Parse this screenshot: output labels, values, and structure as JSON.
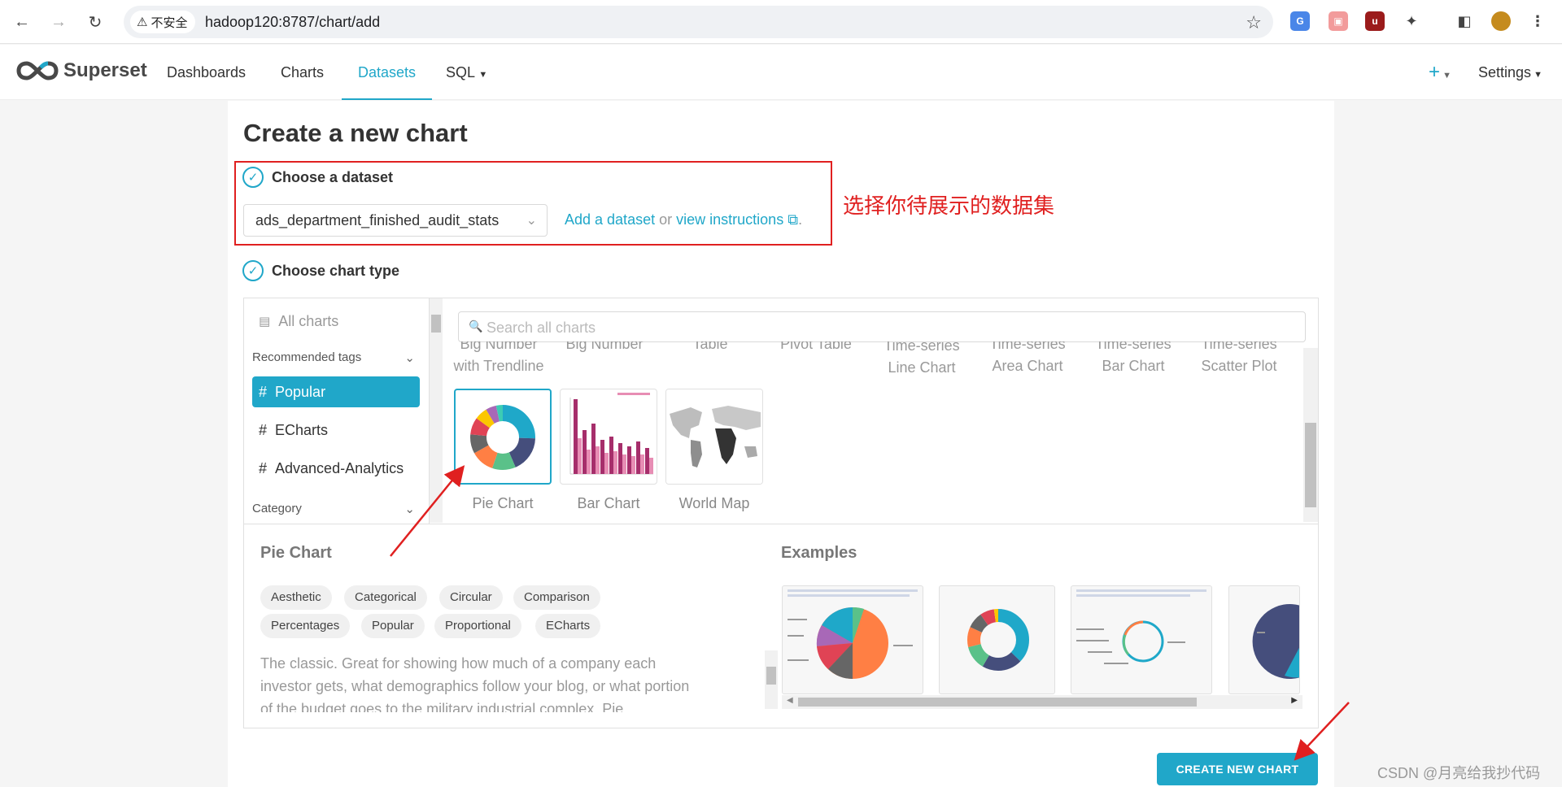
{
  "browser": {
    "insecure_label": "不安全",
    "url": "hadoop120:8787/chart/add"
  },
  "nav": {
    "brand": "Superset",
    "items": [
      {
        "label": "Dashboards",
        "active": false
      },
      {
        "label": "Charts",
        "active": false
      },
      {
        "label": "Datasets",
        "active": true
      },
      {
        "label": "SQL",
        "active": false
      }
    ],
    "plus_label": "+",
    "settings_label": "Settings"
  },
  "page": {
    "title": "Create a new chart",
    "step1_label": "Choose a dataset",
    "dataset_value": "ads_department_finished_audit_stats",
    "add_dataset_link": "Add a dataset",
    "or_text": "or",
    "view_instructions_link": "view instructions",
    "step2_label": "Choose chart type",
    "annotation": "选择你待展示的数据集"
  },
  "sidebar": {
    "all_charts": "All charts",
    "recommended_tags_header": "Recommended tags",
    "tags": [
      {
        "label": "Popular",
        "active": true
      },
      {
        "label": "ECharts",
        "active": false
      },
      {
        "label": "Advanced-Analytics",
        "active": false
      }
    ],
    "category_header": "Category"
  },
  "search": {
    "placeholder": "Search all charts"
  },
  "gallery": {
    "top_row": [
      {
        "line1": "Big Number",
        "line2": "with Trendline"
      },
      {
        "line1": "Big Number",
        "line2": ""
      },
      {
        "line1": "Table",
        "line2": ""
      },
      {
        "line1": "Pivot Table",
        "line2": ""
      },
      {
        "line1": "Time-series",
        "line2": "Line Chart"
      },
      {
        "line1": "Time-series",
        "line2": "Area Chart"
      },
      {
        "line1": "Time-series",
        "line2": "Bar Chart"
      },
      {
        "line1": "Time-series",
        "line2": "Scatter Plot"
      }
    ],
    "cards": [
      {
        "label": "Pie Chart",
        "selected": true
      },
      {
        "label": "Bar Chart",
        "selected": false
      },
      {
        "label": "World Map",
        "selected": false
      }
    ]
  },
  "details": {
    "name": "Pie Chart",
    "examples_header": "Examples",
    "tags": [
      "Aesthetic",
      "Categorical",
      "Circular",
      "Comparison",
      "Percentages",
      "Popular",
      "Proportional",
      "ECharts"
    ],
    "description": "The classic. Great for showing how much of a company each investor gets, what demographics follow your blog, or what portion of the budget goes to the military industrial complex. Pie"
  },
  "actions": {
    "create_button": "CREATE NEW CHART"
  },
  "watermark": "CSDN @月亮给我抄代码",
  "colors": {
    "accent": "#20a7c9",
    "annotation_red": "#e02020"
  }
}
